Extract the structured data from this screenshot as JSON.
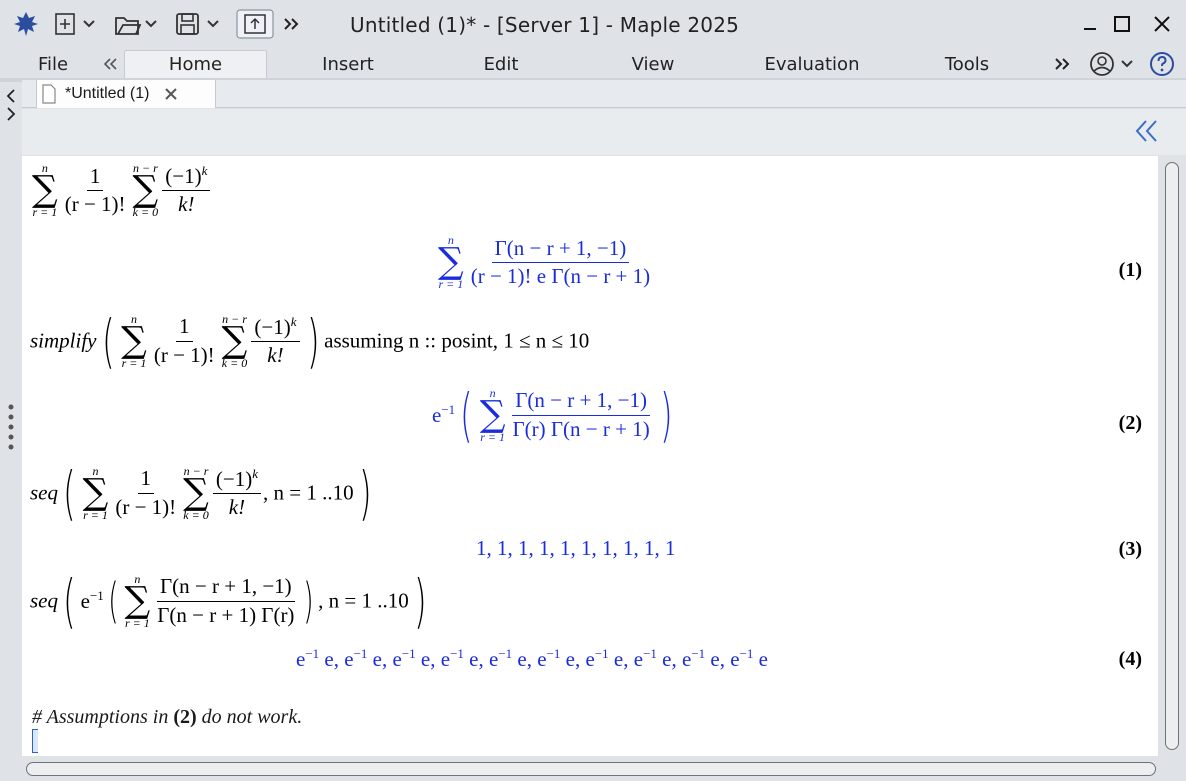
{
  "window": {
    "title": "Untitled (1)* - [Server 1] - Maple 2025"
  },
  "menu": {
    "tabs": [
      {
        "label": "File"
      },
      {
        "label": "Home"
      },
      {
        "label": "Insert"
      },
      {
        "label": "Edit"
      },
      {
        "label": "View"
      },
      {
        "label": "Evaluation"
      },
      {
        "label": "Tools"
      }
    ]
  },
  "document": {
    "tab_label": "*Untitled (1)"
  },
  "math": {
    "in1": {
      "num1": "1",
      "den1": "(r − 1)!",
      "sum_outer_low": "r = 1",
      "sum_outer_up": "n",
      "sum_inner_low": "k = 0",
      "sum_inner_up": "n − r",
      "num2": "(−1)",
      "num2_exp": "k",
      "den2": "k!"
    },
    "out1": {
      "sum_low": "r = 1",
      "sum_up": "n",
      "num": "Γ(n − r + 1, −1)",
      "den": "(r − 1)! e Γ(n − r + 1)",
      "label": "(1)"
    },
    "in2": {
      "func": "simplify",
      "assume": "assuming n :: posint, 1 ≤ n ≤ 10"
    },
    "out2": {
      "prefix": "e",
      "prefix_exp": "−1",
      "num": "Γ(n − r + 1, −1)",
      "den": "Γ(r) Γ(n − r + 1)",
      "label": "(2)"
    },
    "in3": {
      "func": "seq",
      "range": ", n = 1 ..10"
    },
    "out3": {
      "text": "1, 1, 1, 1, 1, 1, 1, 1, 1, 1",
      "label": "(3)"
    },
    "in4": {
      "func": "seq",
      "prefix": "e",
      "prefix_exp": "−1",
      "num": "Γ(n − r + 1, −1)",
      "den": "Γ(n − r + 1) Γ(r)",
      "range": ", n = 1 ..10"
    },
    "out4": {
      "terms": [
        "e",
        "e",
        "e",
        "e",
        "e",
        "e",
        "e",
        "e",
        "e",
        "e"
      ],
      "exp": "−1",
      "label": "(4)"
    },
    "comment_hash": "# ",
    "comment_a": "Assumptions in ",
    "comment_ref": "(2)",
    "comment_b": " do not work."
  }
}
